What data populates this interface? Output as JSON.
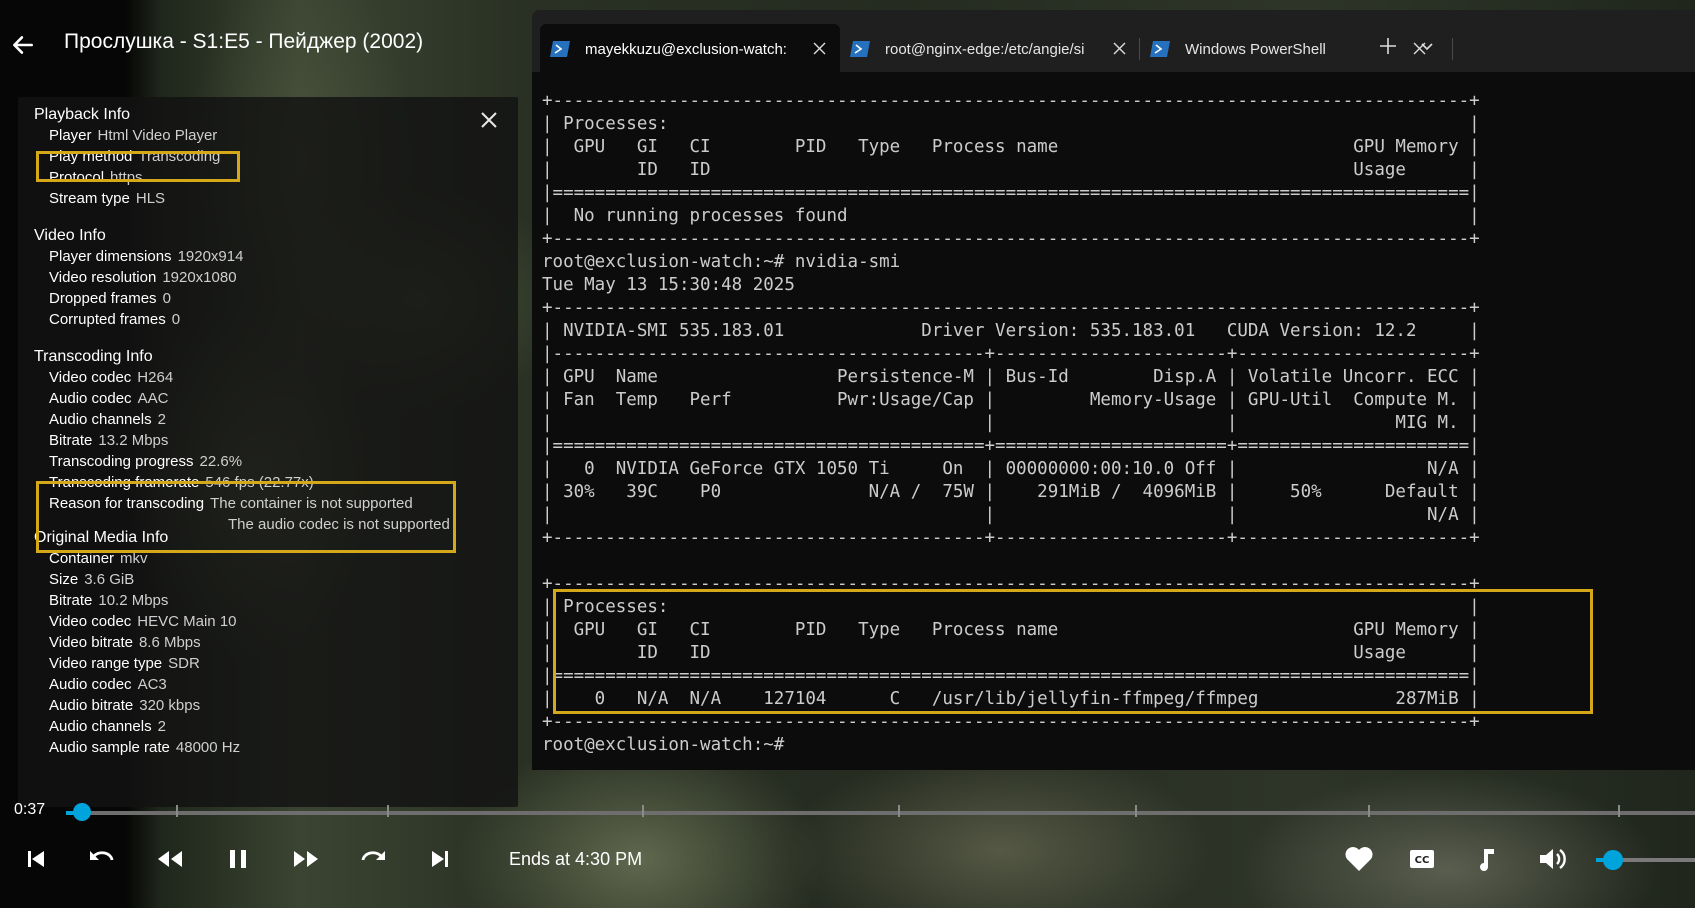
{
  "player": {
    "title": "Прослушка - S1:E5 - Пейджер (2002)",
    "current_time": "0:37",
    "ends_at": "Ends at 4:30 PM",
    "progress_fraction": 0.007,
    "volume_fraction": 0.2,
    "accent_color": "#00a4dc"
  },
  "playback_info": {
    "sections": {
      "playback": {
        "title": "Playback Info",
        "rows": [
          {
            "k": "Player",
            "v": "Html Video Player"
          },
          {
            "k": "Play method",
            "v": "Transcoding"
          },
          {
            "k": "Protocol",
            "v": "https"
          },
          {
            "k": "Stream type",
            "v": "HLS"
          }
        ]
      },
      "video": {
        "title": "Video Info",
        "rows": [
          {
            "k": "Player dimensions",
            "v": "1920x914"
          },
          {
            "k": "Video resolution",
            "v": "1920x1080"
          },
          {
            "k": "Dropped frames",
            "v": "0"
          },
          {
            "k": "Corrupted frames",
            "v": "0"
          }
        ]
      },
      "transcoding": {
        "title": "Transcoding Info",
        "rows": [
          {
            "k": "Video codec",
            "v": "H264"
          },
          {
            "k": "Audio codec",
            "v": "AAC"
          },
          {
            "k": "Audio channels",
            "v": "2"
          },
          {
            "k": "Bitrate",
            "v": "13.2 Mbps"
          },
          {
            "k": "Transcoding progress",
            "v": "22.6%"
          },
          {
            "k": "Transcoding framerate",
            "v": "546 fps (22.77x)"
          },
          {
            "k": "Reason for transcoding",
            "v": "The container is not supported"
          }
        ],
        "reason_line2": "The audio codec is not supported"
      },
      "original": {
        "title": "Original Media Info",
        "rows": [
          {
            "k": "Container",
            "v": "mkv"
          },
          {
            "k": "Size",
            "v": "3.6 GiB"
          },
          {
            "k": "Bitrate",
            "v": "10.2 Mbps"
          },
          {
            "k": "Video codec",
            "v": "HEVC Main 10"
          },
          {
            "k": "Video bitrate",
            "v": "8.6 Mbps"
          },
          {
            "k": "Video range type",
            "v": "SDR"
          },
          {
            "k": "Audio codec",
            "v": "AC3"
          },
          {
            "k": "Audio bitrate",
            "v": "320 kbps"
          },
          {
            "k": "Audio channels",
            "v": "2"
          },
          {
            "k": "Audio sample rate",
            "v": "48000 Hz"
          }
        ]
      }
    },
    "highlight_color": "#d4a818"
  },
  "terminal": {
    "tabs": [
      {
        "label": "mayekkuzu@exclusion-watch:"
      },
      {
        "label": "root@nginx-edge:/etc/angie/si"
      },
      {
        "label": "Windows PowerShell"
      }
    ],
    "output": "+---------------------------------------------------------------------------------------+\n| Processes:                                                                            |\n|  GPU   GI   CI        PID   Type   Process name                            GPU Memory |\n|        ID   ID                                                             Usage      |\n|=======================================================================================|\n|  No running processes found                                                           |\n+---------------------------------------------------------------------------------------+\nroot@exclusion-watch:~# nvidia-smi\nTue May 13 15:30:48 2025\n+---------------------------------------------------------------------------------------+\n| NVIDIA-SMI 535.183.01             Driver Version: 535.183.01   CUDA Version: 12.2     |\n|-----------------------------------------+----------------------+----------------------+\n| GPU  Name                 Persistence-M | Bus-Id        Disp.A | Volatile Uncorr. ECC |\n| Fan  Temp   Perf          Pwr:Usage/Cap |         Memory-Usage | GPU-Util  Compute M. |\n|                                         |                      |               MIG M. |\n|=========================================+======================+======================|\n|   0  NVIDIA GeForce GTX 1050 Ti     On  | 00000000:00:10.0 Off |                  N/A |\n| 30%   39C    P0              N/A /  75W |    291MiB /  4096MiB |     50%      Default |\n|                                         |                      |                  N/A |\n+-----------------------------------------+----------------------+----------------------+\n\n+---------------------------------------------------------------------------------------+\n| Processes:                                                                            |\n|  GPU   GI   CI        PID   Type   Process name                            GPU Memory |\n|        ID   ID                                                             Usage      |\n|=======================================================================================|\n|    0   N/A  N/A    127104      C   /usr/lib/jellyfin-ffmpeg/ffmpeg             287MiB |\n+---------------------------------------------------------------------------------------+\nroot@exclusion-watch:~#"
  },
  "icons": {
    "back": "arrow-left-icon",
    "close": "close-icon",
    "terminal_tab": "powershell-icon",
    "new_tab": "plus-icon",
    "dropdown": "chevron-down-icon",
    "controls": [
      "skip-previous-icon",
      "rewind-icon",
      "fast-rewind-icon",
      "pause-icon",
      "fast-forward-icon",
      "forward-icon",
      "skip-next-icon",
      "heart-icon",
      "closed-captions-icon",
      "music-note-icon",
      "volume-icon"
    ]
  }
}
